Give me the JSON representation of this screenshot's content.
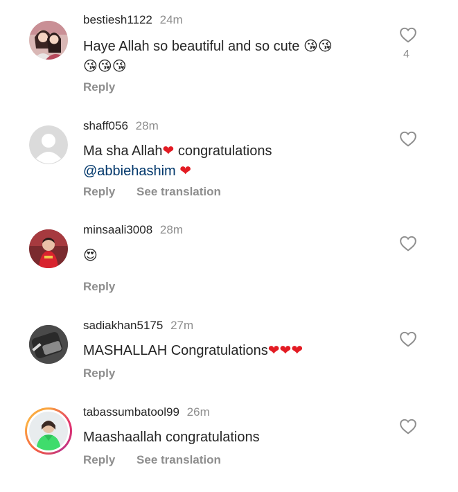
{
  "comments": [
    {
      "username": "bestiesh1122",
      "time": "24m",
      "text_line1": "Haye Allah so beautiful and so cute ",
      "emoji_line1": "😘😘",
      "emoji_line2": "😘😘😘",
      "actions": [
        "Reply"
      ],
      "likes": "4",
      "avatar": "two-women-photo"
    },
    {
      "username": "shaff056",
      "time": "28m",
      "text_line1": "Ma sha Allah",
      "heart1": "❤",
      "text_line1b": " congratulations",
      "mention": "@abbiehashim",
      "heart2": "❤",
      "actions": [
        "Reply",
        "See translation"
      ],
      "avatar": "default-avatar"
    },
    {
      "username": "minsaali3008",
      "time": "28m",
      "emoji": "😍",
      "actions": [
        "Reply"
      ],
      "avatar": "child-photo"
    },
    {
      "username": "sadiakhan5175",
      "time": "27m",
      "text": "MASHALLAH Congratulations",
      "hearts": "❤❤❤",
      "actions": [
        "Reply"
      ],
      "avatar": "phone-photo"
    },
    {
      "username": "tabassumbatool99",
      "time": "26m",
      "text": "Maashaallah congratulations",
      "actions": [
        "Reply",
        "See translation"
      ],
      "avatar": "woman-green-photo"
    }
  ],
  "colors": {
    "accent_heart": "#e31b23",
    "mention": "#00376b",
    "muted": "#8e8e8e"
  }
}
